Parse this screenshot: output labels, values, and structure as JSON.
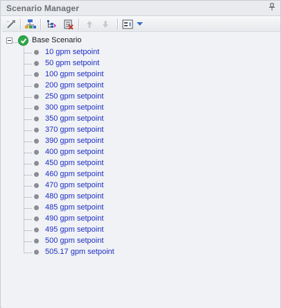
{
  "panel": {
    "title": "Scenario Manager",
    "pin_icon": "pin-icon"
  },
  "toolbar": {
    "buttons": [
      {
        "name": "wand-icon-button",
        "enabled": true
      },
      {
        "name": "clone-scenario-button",
        "enabled": true
      },
      {
        "name": "promote-button",
        "enabled": true
      },
      {
        "name": "delete-button",
        "enabled": true
      },
      {
        "name": "move-up-button",
        "enabled": false
      },
      {
        "name": "move-down-button",
        "enabled": false
      },
      {
        "name": "view-options-button",
        "enabled": true
      }
    ]
  },
  "tree": {
    "root": {
      "label": "Base Scenario",
      "status": "ok",
      "expanded": true
    },
    "children": [
      {
        "label": "10 gpm setpoint"
      },
      {
        "label": "50 gpm setpoint"
      },
      {
        "label": "100 gpm setpoint"
      },
      {
        "label": "200 gpm setpoint"
      },
      {
        "label": "250 gpm setpoint"
      },
      {
        "label": "300 gpm setpoint"
      },
      {
        "label": "350 gpm setpoint"
      },
      {
        "label": "370 gpm setpoint"
      },
      {
        "label": "390 gpm setpoint"
      },
      {
        "label": "400 gpm setpoint"
      },
      {
        "label": "450 gpm setpoint"
      },
      {
        "label": "460 gpm setpoint"
      },
      {
        "label": "470 gpm setpoint"
      },
      {
        "label": "480 gpm setpoint"
      },
      {
        "label": "485 gpm setpoint"
      },
      {
        "label": "490 gpm setpoint"
      },
      {
        "label": "495 gpm setpoint"
      },
      {
        "label": "500 gpm setpoint"
      },
      {
        "label": "505.17 gpm setpoint"
      }
    ]
  },
  "colors": {
    "child_text": "#1d2ec4",
    "status_ok": "#2fa74a",
    "bullet": "#8a8d92"
  }
}
